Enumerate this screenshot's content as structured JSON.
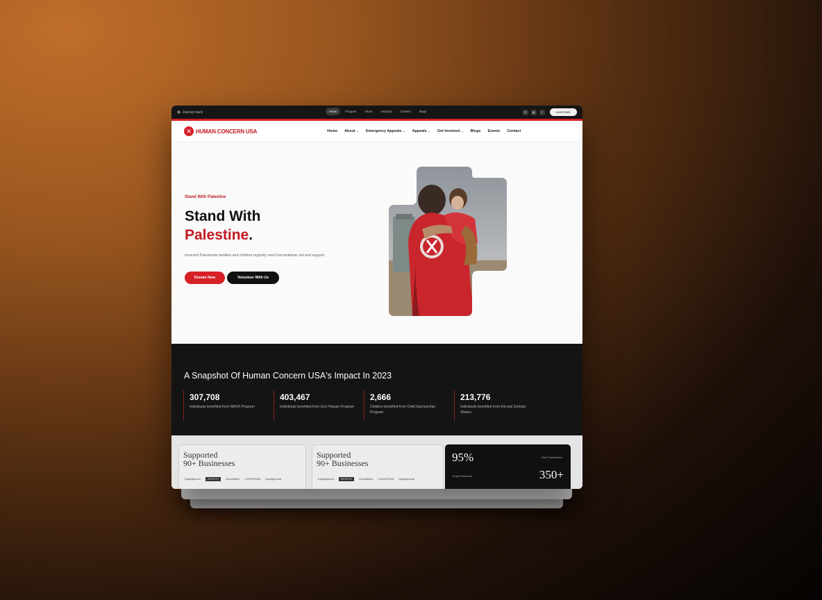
{
  "topbar": {
    "brand": "Journey back",
    "nav": [
      "Home",
      "Program",
      "About",
      "Analytics",
      "Careers",
      "Blogs"
    ],
    "icons": [
      "mail-icon",
      "grid-icon",
      "arrow-icon"
    ],
    "cta": "Learn More"
  },
  "nav": {
    "logo": "HUMAN CONCERN USA",
    "items": [
      {
        "label": "Home",
        "dropdown": false
      },
      {
        "label": "About",
        "dropdown": true
      },
      {
        "label": "Emergency Appeals",
        "dropdown": true
      },
      {
        "label": "Appeals",
        "dropdown": true
      },
      {
        "label": "Get Involved",
        "dropdown": true
      },
      {
        "label": "Blogs",
        "dropdown": false
      },
      {
        "label": "Events",
        "dropdown": false
      },
      {
        "label": "Contact",
        "dropdown": false
      }
    ]
  },
  "hero": {
    "kicker": "Stand With Palestine",
    "title_line1": "Stand With",
    "title_red": "Palestine",
    "title_dot": ".",
    "description": "Innocent Palestinian families and children urgently need humanitarian aid and support.",
    "donate_label": "Donate Now",
    "volunteer_label": "Volunteer With Us"
  },
  "impact": {
    "heading": "A Snapshot Of Human Concern USA's Impact In 2023",
    "stats": [
      {
        "value": "307,708",
        "label": "Individuals benefited from WASH Program"
      },
      {
        "value": "403,467",
        "label": "Individuals benefited from Zero Hunger Program"
      },
      {
        "value": "2,666",
        "label": "Children benefited from Child Sponsorship Program"
      },
      {
        "value": "213,776",
        "label": "Individuals benefited from Eid and Qurbani Shares"
      }
    ]
  },
  "cards": {
    "card1": {
      "title_line1": "Supported",
      "title_line2": "90+ Businesses"
    },
    "card2": {
      "title_line1": "Supported",
      "title_line2": "90+ Businesses"
    },
    "logos": [
      "Dogelgeneral",
      "WEBSTR",
      "CloudWatch",
      "LOGOIPSUM",
      "Dogelgeneral"
    ],
    "dark": {
      "percent": "95%",
      "small_top": "Client Satisfaction",
      "small_bottom": "Project Delivered",
      "count": "350+"
    }
  },
  "colors": {
    "brand_red": "#d71f26",
    "dark": "#141414",
    "accent_orange": "#c06e2a"
  }
}
